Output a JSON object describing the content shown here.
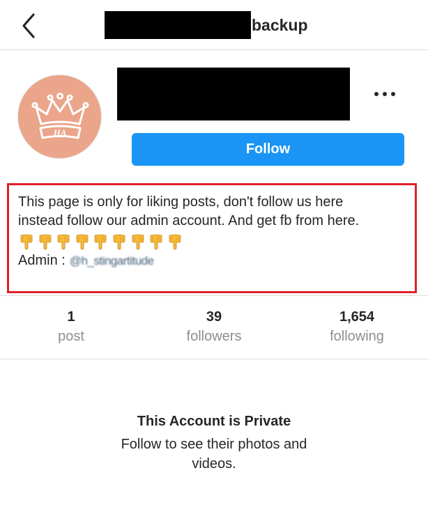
{
  "header": {
    "title_suffix": "backup",
    "back_icon": "chevron-left-icon"
  },
  "profile": {
    "avatar_text": "HA",
    "avatar_icon": "crown-logo",
    "follow_label": "Follow",
    "more_icon": "more-horizontal-icon"
  },
  "bio": {
    "line1": "This page is only for liking posts, don't follow us here",
    "line2": "instead follow our admin account. And get fb from here.",
    "emoji_count": 9,
    "emoji_name": "backhand-index-pointing-down",
    "admin_label": "Admin :",
    "admin_handle": "@h_stingartitude"
  },
  "stats": [
    {
      "count": "1",
      "label": "post"
    },
    {
      "count": "39",
      "label": "followers"
    },
    {
      "count": "1,654",
      "label": "following"
    }
  ],
  "private": {
    "title": "This Account is Private",
    "subtitle": "Follow to see their photos and videos."
  },
  "colors": {
    "follow_button": "#1a95f5",
    "highlight_border": "#e0202a",
    "avatar_bg": "#eaa58a",
    "muted_text": "#8e8e8e"
  }
}
